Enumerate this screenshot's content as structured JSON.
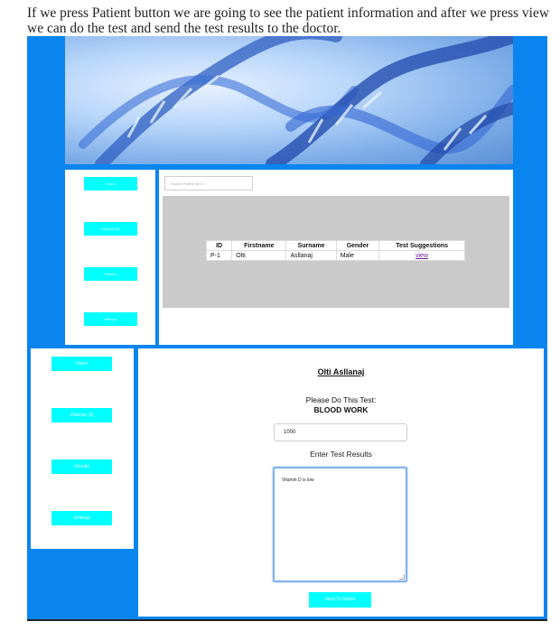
{
  "caption": "If we press Patient button we are going to see the patient information and after we press view we can do the test and send the test results to the doctor.",
  "colors": {
    "page_blue": "#0a85f0",
    "nav_cyan": "#00ffff",
    "grey_panel": "#cacaca",
    "link_purple": "#6b1f9e"
  },
  "banner": {
    "icon": "dna-helix-image"
  },
  "shot1": {
    "sidebar": [
      {
        "label": "Home"
      },
      {
        "label": "Patients (3)"
      },
      {
        "label": "Results"
      },
      {
        "label": "Settings"
      }
    ],
    "search_placeholder": "Search Patient By ID",
    "table": {
      "headers": [
        "ID",
        "Firstname",
        "Surname",
        "Gender",
        "Test Suggestions"
      ],
      "rows": [
        {
          "id": "P-1",
          "firstname": "Olti",
          "surname": "Asllanaj",
          "gender": "Male",
          "link": "view"
        }
      ]
    }
  },
  "shot2": {
    "sidebar": [
      {
        "label": "Home"
      },
      {
        "label": "Patients (3)"
      },
      {
        "label": "Results"
      },
      {
        "label": "Settings"
      }
    ],
    "patient_name": "Olti Asllanaj",
    "instruction": "Please Do This Test:",
    "test_name": "BLOOD WORK",
    "code_value": "1000",
    "enter_label": "Enter Test Results",
    "result_value": "Vitamin D is low",
    "send_label": "Send To Doctor"
  }
}
